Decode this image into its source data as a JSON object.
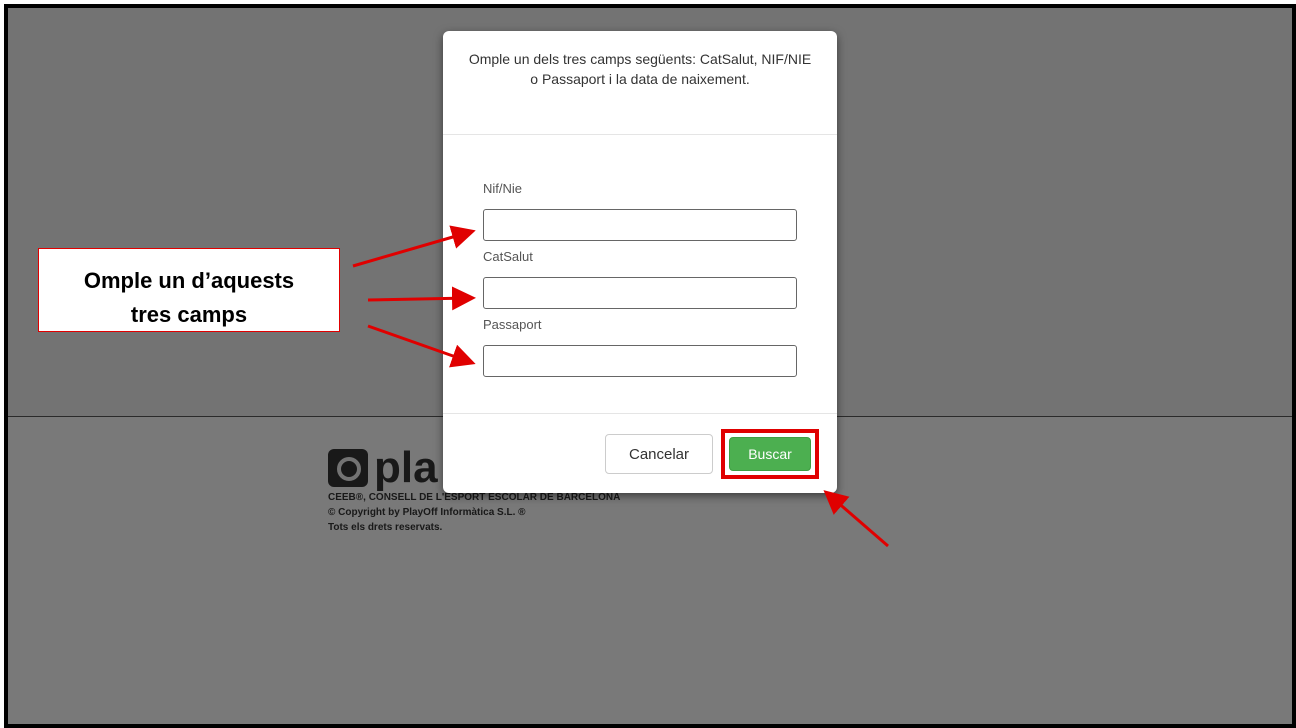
{
  "footer": {
    "logo_text": "pla",
    "company": "CEEB®, CONSELL DE L'ESPORT ESCOLAR DE BARCELONA",
    "copyright": "© Copyright by PlayOff Informàtica S.L. ®",
    "rights": "Tots els drets reservats."
  },
  "modal": {
    "header": "Omple un dels tres camps següents: CatSalut, NIF/NIE o Passaport i la data de naixement.",
    "fields": [
      {
        "label": "Nif/Nie",
        "value": "",
        "placeholder": ""
      },
      {
        "label": "CatSalut",
        "value": "",
        "placeholder": ""
      },
      {
        "label": "Passaport",
        "value": "",
        "placeholder": ""
      }
    ],
    "cancel_label": "Cancelar",
    "search_label": "Buscar"
  },
  "annotation": {
    "callout_line1": "Omple un d’aquests",
    "callout_line2": "tres camps"
  },
  "colors": {
    "search_button": "#4caf50",
    "highlight": "#e00000",
    "backdrop": "rgba(0,0,0,0.5)"
  }
}
